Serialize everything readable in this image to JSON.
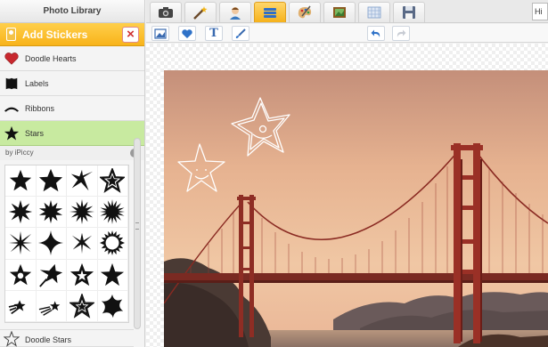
{
  "library": {
    "title": "Photo Library"
  },
  "stickers_panel": {
    "title": "Add Stickers",
    "close_icon": "close-icon",
    "categories": [
      {
        "label": "Doodle Hearts",
        "icon": "heart-icon"
      },
      {
        "label": "Labels",
        "icon": "label-icon"
      },
      {
        "label": "Ribbons",
        "icon": "ribbon-icon"
      },
      {
        "label": "Stars",
        "icon": "star-icon",
        "active": true
      }
    ],
    "by_line": "by iPiccy",
    "info_icon": "info-icon",
    "next_category": {
      "label": "Doodle Stars",
      "icon": "doodle-star-icon"
    },
    "active_color": "#c8eaa0"
  },
  "top_tabs": [
    {
      "icon": "camera-icon"
    },
    {
      "icon": "magic-wand-icon"
    },
    {
      "icon": "person-icon"
    },
    {
      "icon": "layers-icon",
      "active": true
    },
    {
      "icon": "paint-palette-icon"
    },
    {
      "icon": "frame-icon"
    },
    {
      "icon": "texture-icon"
    },
    {
      "icon": "save-icon"
    }
  ],
  "user": {
    "label": "Hi A"
  },
  "sub_tools": [
    {
      "icon": "image-icon"
    },
    {
      "icon": "heart-icon"
    },
    {
      "icon": "text-icon",
      "label": "T"
    },
    {
      "icon": "brush-icon"
    }
  ],
  "history": [
    {
      "icon": "undo-icon"
    },
    {
      "icon": "redo-icon"
    }
  ],
  "accent_color": "#f8b31a"
}
